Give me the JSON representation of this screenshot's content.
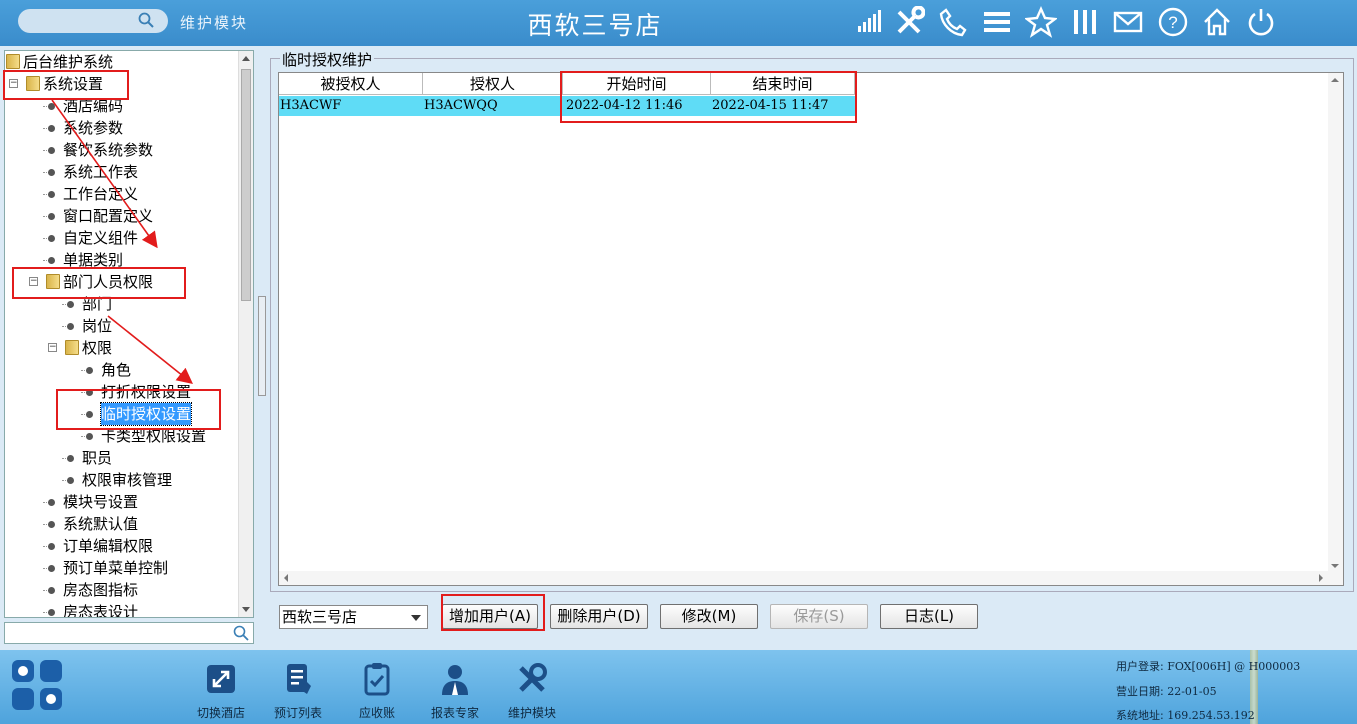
{
  "header": {
    "search_placeholder": "",
    "module_title": "维护模块",
    "store_title": "西软三号店",
    "icons": [
      "signal-icon",
      "tools-icon",
      "phone-icon",
      "menu-icon",
      "star-icon",
      "columns-icon",
      "mail-icon",
      "help-icon",
      "home-icon",
      "power-icon"
    ]
  },
  "tree": {
    "items": [
      {
        "label": "后台维护系统",
        "level": 0,
        "type": "folder"
      },
      {
        "label": "系统设置",
        "level": 1,
        "type": "folder",
        "expanded": true
      },
      {
        "label": "酒店编码",
        "level": 2,
        "type": "leaf"
      },
      {
        "label": "系统参数",
        "level": 2,
        "type": "leaf"
      },
      {
        "label": "餐饮系统参数",
        "level": 2,
        "type": "leaf"
      },
      {
        "label": "系统工作表",
        "level": 2,
        "type": "leaf"
      },
      {
        "label": "工作台定义",
        "level": 2,
        "type": "leaf"
      },
      {
        "label": "窗口配置定义",
        "level": 2,
        "type": "leaf"
      },
      {
        "label": "自定义组件",
        "level": 2,
        "type": "leaf"
      },
      {
        "label": "单据类别",
        "level": 2,
        "type": "leaf"
      },
      {
        "label": "部门人员权限",
        "level": 2,
        "type": "folder",
        "expanded": true
      },
      {
        "label": "部门",
        "level": 3,
        "type": "leaf"
      },
      {
        "label": "岗位",
        "level": 3,
        "type": "leaf"
      },
      {
        "label": "权限",
        "level": 3,
        "type": "folder",
        "expanded": true
      },
      {
        "label": "角色",
        "level": 4,
        "type": "leaf"
      },
      {
        "label": "打折权限设置",
        "level": 4,
        "type": "leaf"
      },
      {
        "label": "临时授权设置",
        "level": 4,
        "type": "leaf",
        "selected": true
      },
      {
        "label": "卡类型权限设置",
        "level": 4,
        "type": "leaf"
      },
      {
        "label": "职员",
        "level": 3,
        "type": "leaf"
      },
      {
        "label": "权限审核管理",
        "level": 3,
        "type": "leaf"
      },
      {
        "label": "模块号设置",
        "level": 2,
        "type": "leaf"
      },
      {
        "label": "系统默认值",
        "level": 2,
        "type": "leaf"
      },
      {
        "label": "订单编辑权限",
        "level": 2,
        "type": "leaf"
      },
      {
        "label": "预订单菜单控制",
        "level": 2,
        "type": "leaf"
      },
      {
        "label": "房态图指标",
        "level": 2,
        "type": "leaf"
      },
      {
        "label": "房态表设计",
        "level": 2,
        "type": "leaf"
      }
    ],
    "search_value": ""
  },
  "main": {
    "group_title": "临时授权维护",
    "columns": [
      "被授权人",
      "授权人",
      "开始时间",
      "结束时间"
    ],
    "rows": [
      [
        "H3ACWF",
        "H3ACWQQ",
        "2022-04-12 11:46",
        "2022-04-15 11:47"
      ]
    ]
  },
  "controls": {
    "store_select_value": "西软三号店",
    "add_user": "增加用户(A)",
    "delete_user": "删除用户(D)",
    "modify": "修改(M)",
    "save": "保存(S)",
    "log": "日志(L)"
  },
  "dock": {
    "items": [
      {
        "label": "切换酒店",
        "icon": "switch-hotel-icon"
      },
      {
        "label": "预订列表",
        "icon": "booking-list-icon"
      },
      {
        "label": "应收账",
        "icon": "receivable-icon"
      },
      {
        "label": "报表专家",
        "icon": "report-expert-icon"
      },
      {
        "label": "维护模块",
        "icon": "maintenance-icon"
      }
    ]
  },
  "status": {
    "login_label": "用户登录:",
    "login_value": "FOX[006H] @ H000003",
    "date_label": "营业日期:",
    "date_value": "22-01-05",
    "address_label": "系统地址:",
    "address_value": "169.254.53.192"
  },
  "colors": {
    "accent_top": "#3a8ccb",
    "selection_row": "#5fdcf6",
    "tree_selection": "#3399ff",
    "annotation_red": "#e21c1c"
  }
}
